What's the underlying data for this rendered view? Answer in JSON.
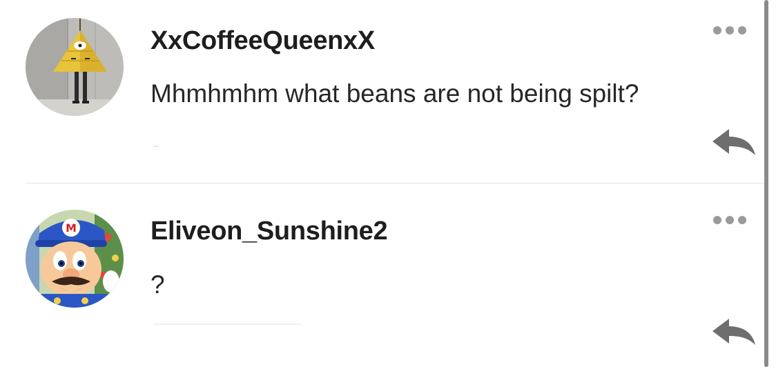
{
  "comments": [
    {
      "username": "XxCoffeeQueenxX",
      "message": "Mhmhmhm what beans are not being spilt?",
      "avatar_icon": "pyramid-costume-avatar-icon"
    },
    {
      "username": "Eliveon_Sunshine2",
      "message": "?",
      "avatar_icon": "plumber-character-avatar-icon"
    }
  ],
  "icons": {
    "more": "more-options-icon",
    "reply": "reply-icon"
  },
  "colors": {
    "text": "#222222",
    "icon_gray": "#6e6e6e",
    "dots": "#9a9a9a",
    "divider": "#e4e4e4"
  }
}
